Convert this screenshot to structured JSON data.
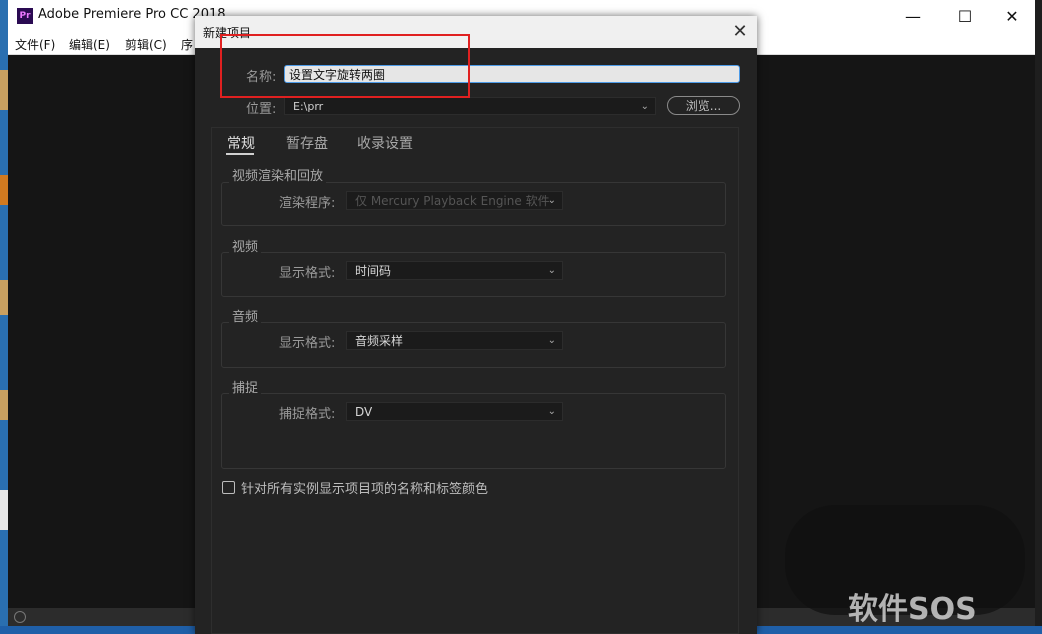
{
  "app": {
    "logo_text": "Pr",
    "title": "Adobe Premiere Pro CC 2018",
    "menu": [
      "文件(F)",
      "编辑(E)",
      "剪辑(C)",
      "序"
    ],
    "window_controls": {
      "minimize": "—",
      "maximize": "☐",
      "close": "✕"
    }
  },
  "dialog": {
    "title": "新建项目",
    "close": "✕",
    "name_label": "名称:",
    "name_value": "设置文字旋转两圈",
    "location_label": "位置:",
    "location_value": "E:\\prr",
    "browse_label": "浏览...",
    "tabs": [
      "常规",
      "暂存盘",
      "收录设置"
    ],
    "groups": {
      "video_render": {
        "title": "视频渲染和回放",
        "renderer_label": "渲染程序:",
        "renderer_value": "仅 Mercury Playback Engine 软件"
      },
      "video": {
        "title": "视频",
        "format_label": "显示格式:",
        "format_value": "时间码"
      },
      "audio": {
        "title": "音频",
        "format_label": "显示格式:",
        "format_value": "音频采样"
      },
      "capture": {
        "title": "捕捉",
        "format_label": "捕捉格式:",
        "format_value": "DV"
      }
    },
    "checkbox_label": "针对所有实例显示项目项的名称和标签颜色",
    "checkbox_checked": false
  },
  "watermark": "软件SOS",
  "colors": {
    "highlight": "#e02020",
    "dialog_bg": "#232323",
    "input_focus": "#4d9be8"
  }
}
